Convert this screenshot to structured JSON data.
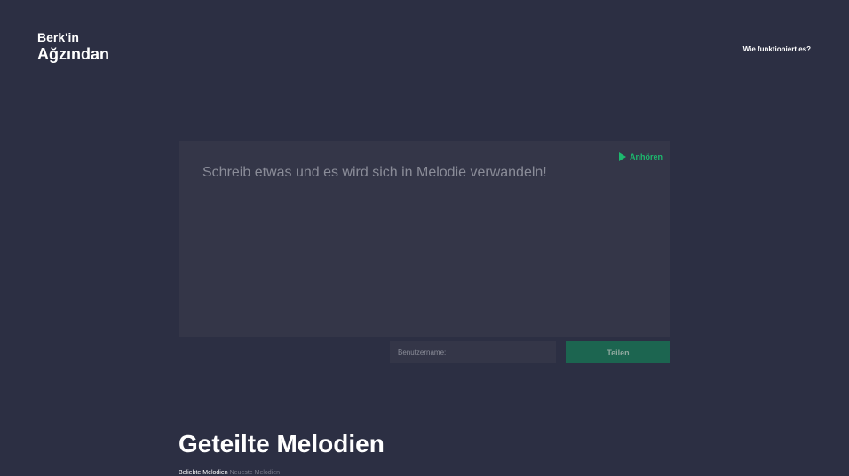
{
  "header": {
    "logo_line1": "Berk'in",
    "logo_line2": "Ağzından",
    "nav_link": "Wie funktioniert es?"
  },
  "editor": {
    "placeholder": "Schreib etwas und es wird sich in Melodie verwandeln!",
    "play_label": "Anhören",
    "play_icon": "play-icon"
  },
  "share": {
    "username_placeholder": "Benutzername:",
    "button_label": "Teilen"
  },
  "shared": {
    "title": "Geteilte Melodien",
    "sub_primary": "Beliebte Melodien",
    "sub_secondary": "Neueste Melodien"
  },
  "colors": {
    "background": "#2c2f43",
    "panel": "#343648",
    "accent": "#1db86e",
    "button": "#1c6550"
  }
}
